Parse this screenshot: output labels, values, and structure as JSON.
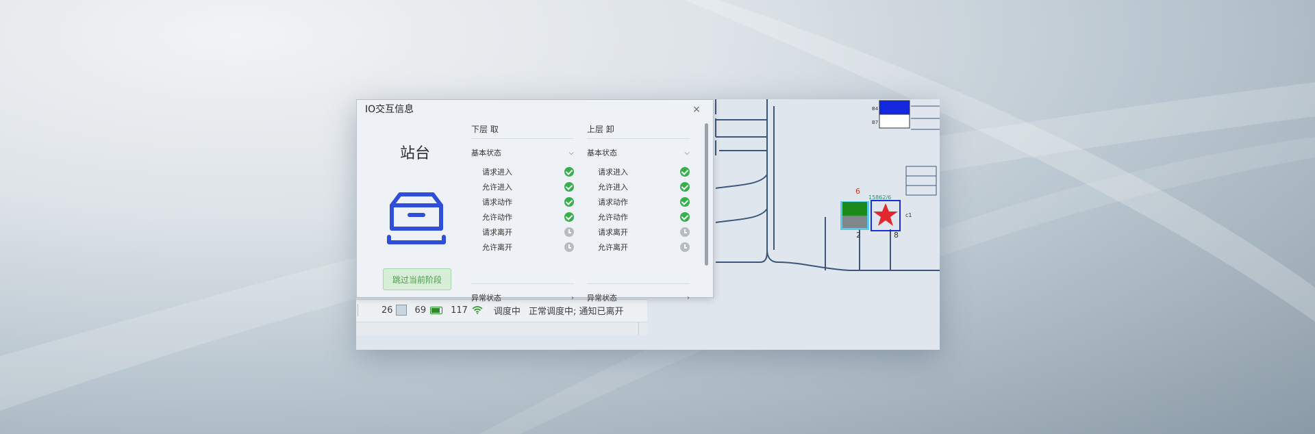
{
  "dialog": {
    "title": "IO交互信息",
    "close": "×",
    "station_title": "站台",
    "skip_button": "跳过当前阶段"
  },
  "columns": [
    {
      "header": "下层 取",
      "group": "基本状态",
      "rows": [
        {
          "label": "请求进入",
          "state": "done"
        },
        {
          "label": "允许进入",
          "state": "done"
        },
        {
          "label": "请求动作",
          "state": "done"
        },
        {
          "label": "允许动作",
          "state": "done"
        },
        {
          "label": "请求离开",
          "state": "pending"
        },
        {
          "label": "允许离开",
          "state": "pending"
        }
      ],
      "abnormal": "异常状态"
    },
    {
      "header": "上层 卸",
      "group": "基本状态",
      "rows": [
        {
          "label": "请求进入",
          "state": "done"
        },
        {
          "label": "允许进入",
          "state": "done"
        },
        {
          "label": "请求动作",
          "state": "done"
        },
        {
          "label": "允许动作",
          "state": "done"
        },
        {
          "label": "请求离开",
          "state": "pending"
        },
        {
          "label": "允许离开",
          "state": "pending"
        }
      ],
      "abnormal": "异常状态"
    }
  ],
  "status_bar": {
    "count_a": "26",
    "battery": "69",
    "signal": "117",
    "mode": "调度中",
    "message": "正常调度中; 通知已离开"
  },
  "map": {
    "label_6": "6",
    "label_id": "15862/6",
    "label_2": "2",
    "label_8": "8",
    "label_c1": "c1",
    "label_b4": "B4",
    "label_b7": "B7"
  },
  "colors": {
    "accent_blue": "#2f4fd8",
    "ok_green": "#35b04b",
    "pending_gray": "#b7bcc1",
    "track": "#3c5578"
  }
}
